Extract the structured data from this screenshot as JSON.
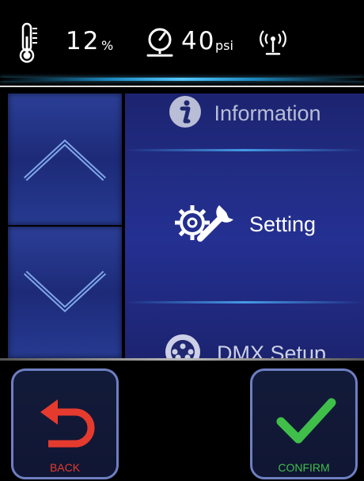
{
  "status": {
    "humidity_value": "12",
    "humidity_unit": "%",
    "pressure_value": "40",
    "pressure_unit": "psi",
    "icons": [
      "thermometer-icon",
      "pressure-gauge-icon",
      "antenna-signal-icon"
    ]
  },
  "menu": {
    "items": [
      {
        "label": "Information",
        "icon": "info-icon"
      },
      {
        "label": "Setting",
        "icon": "gear-wrench-icon"
      },
      {
        "label": "DMX Setup",
        "icon": "dmx-connector-icon"
      }
    ],
    "selected_index": 1
  },
  "actions": {
    "back_label": "BACK",
    "confirm_label": "CONFIRM"
  },
  "colors": {
    "accent_blue": "#54c7ff",
    "panel_blue": "#222d86",
    "back_red": "#e53b2e",
    "confirm_green": "#3fbf4a"
  }
}
